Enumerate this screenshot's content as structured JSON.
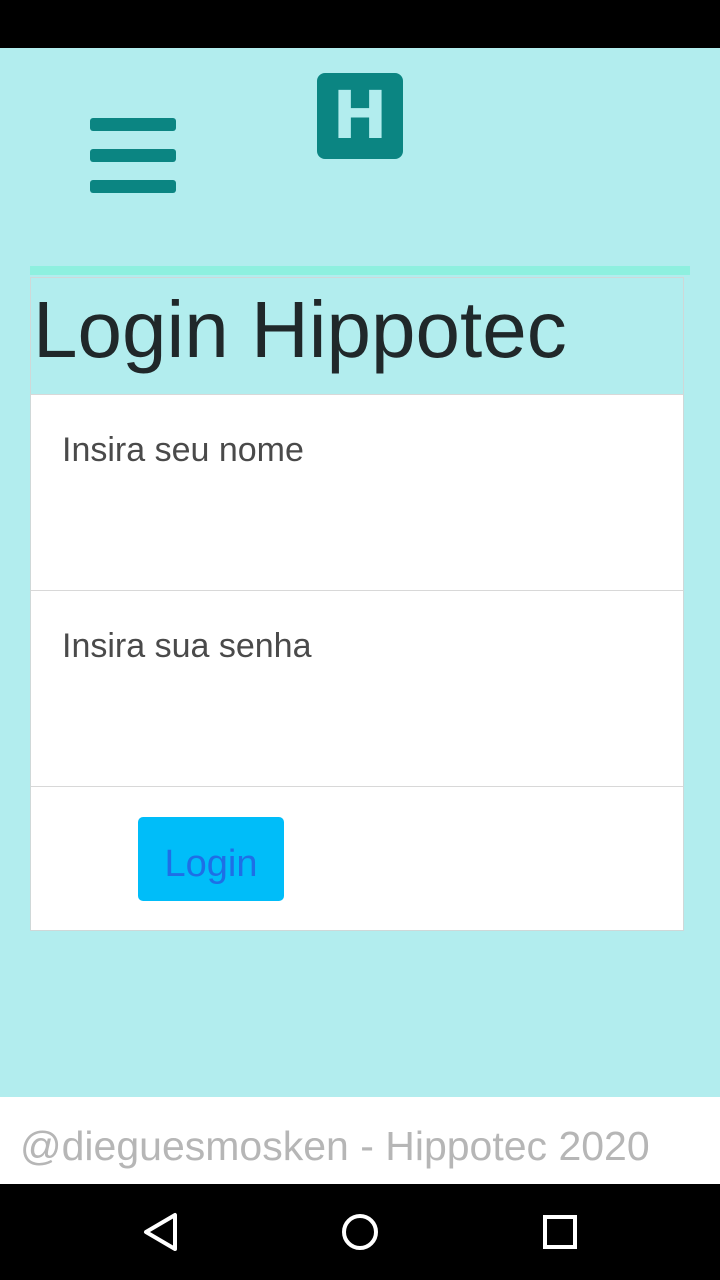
{
  "header": {
    "menu_icon": "hamburger-menu-icon",
    "logo_letter": "H"
  },
  "login": {
    "title": "Login Hippotec",
    "name_placeholder": "Insira seu nome",
    "password_placeholder": "Insira sua senha",
    "button_label": "Login"
  },
  "footer": {
    "text": "@dieguesmosken - Hippotec 2020"
  },
  "nav": {
    "back_icon": "back-triangle-icon",
    "home_icon": "home-circle-icon",
    "recents_icon": "recents-square-icon"
  },
  "colors": {
    "background": "#b2edee",
    "accent": "#0b8582",
    "button": "#00bdf9",
    "button_text": "#1e6fe6"
  }
}
